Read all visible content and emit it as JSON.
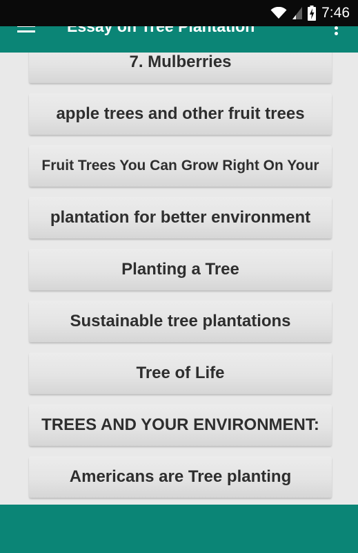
{
  "status_bar": {
    "time": "7:46",
    "icons": [
      "wifi-icon",
      "signal-icon",
      "battery-charging-icon"
    ]
  },
  "app_bar": {
    "title": "Essay on Tree Plantation",
    "icons": [
      "menu-icon",
      "overflow-menu-icon"
    ]
  },
  "list": {
    "items": [
      {
        "label": "7. Mulberries"
      },
      {
        "label": "apple trees and other fruit trees"
      },
      {
        "label": "Fruit Trees You Can Grow Right On Your"
      },
      {
        "label": "plantation for better environment"
      },
      {
        "label": "Planting a Tree"
      },
      {
        "label": "Sustainable tree plantations"
      },
      {
        "label": "Tree of Life"
      },
      {
        "label": "TREES AND YOUR ENVIRONMENT:"
      },
      {
        "label": "Americans are  Tree  planting"
      }
    ]
  },
  "colors": {
    "accent": "#0b8576",
    "status_bar": "#0a0a0a",
    "background": "#e9e9e9",
    "item_text": "#2e2e2e"
  }
}
